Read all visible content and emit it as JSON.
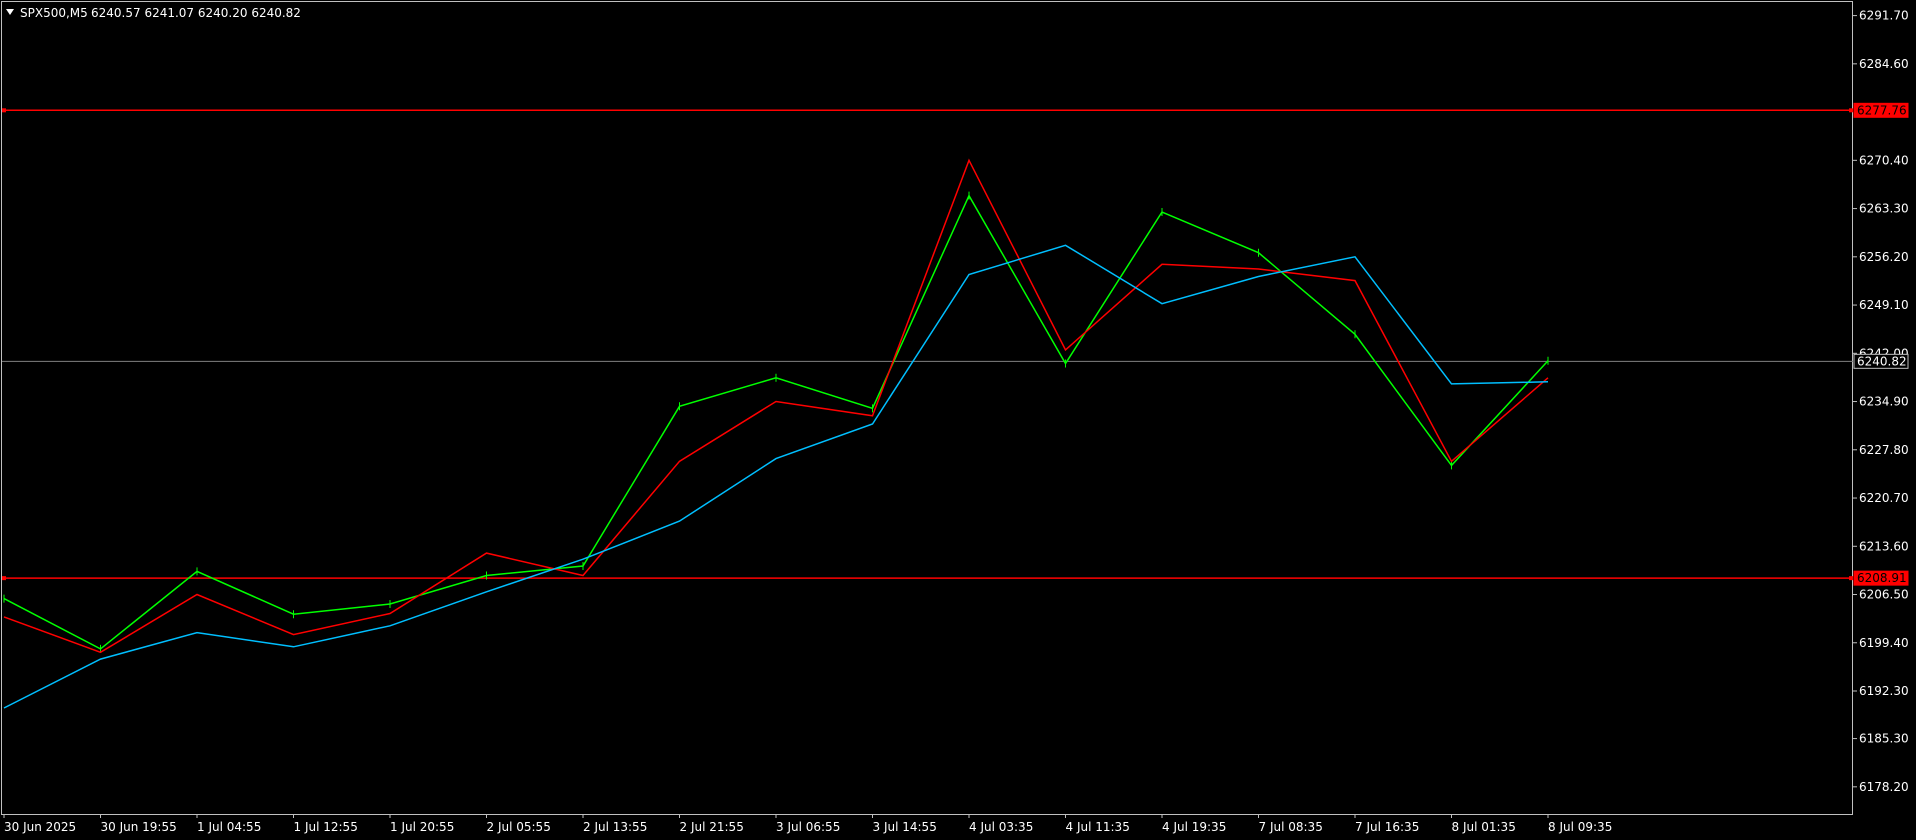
{
  "header": {
    "symbol_timeframe": "SPX500,M5",
    "ohlc": "6240.57 6241.07 6240.20 6240.82"
  },
  "colors": {
    "background": "#000000",
    "frame": "#c0c0c0",
    "text": "#ffffff",
    "bars": "#00ff00",
    "ma_fast": "#ff0000",
    "ma_slow": "#00bfff",
    "level_line": "#ff0000",
    "current_price_line": "#808080"
  },
  "icons": {
    "menu": "triangle-down-icon"
  },
  "chart_data": {
    "type": "line",
    "title": "",
    "xlabel": "",
    "ylabel": "",
    "ylim": [
      6174.2,
      6293.7
    ],
    "y_ticks": [
      "6291.70",
      "6284.60",
      "6270.40",
      "6263.30",
      "6256.20",
      "6249.10",
      "6242.00",
      "6234.90",
      "6227.80",
      "6220.70",
      "6213.60",
      "6206.50",
      "6199.40",
      "6192.30",
      "6185.30",
      "6178.20"
    ],
    "x_ticks": [
      "30 Jun 2025",
      "30 Jun 19:55",
      "1 Jul 04:55",
      "1 Jul 12:55",
      "1 Jul 20:55",
      "2 Jul 05:55",
      "2 Jul 13:55",
      "2 Jul 21:55",
      "3 Jul 06:55",
      "3 Jul 14:55",
      "4 Jul 03:35",
      "4 Jul 11:35",
      "4 Jul 19:35",
      "7 Jul 08:35",
      "7 Jul 16:35",
      "8 Jul 01:35",
      "8 Jul 09:35"
    ],
    "x": [
      "30 Jun 2025",
      "30 Jun 19:55",
      "1 Jul 04:55",
      "1 Jul 12:55",
      "1 Jul 20:55",
      "2 Jul 05:55",
      "2 Jul 13:55",
      "2 Jul 21:55",
      "3 Jul 06:55",
      "3 Jul 14:55",
      "4 Jul 03:35",
      "4 Jul 11:35",
      "4 Jul 19:35",
      "7 Jul 08:35",
      "7 Jul 16:35",
      "8 Jul 01:35",
      "8 Jul 09:35"
    ],
    "series": [
      {
        "values": [
          6205.9,
          6198.5,
          6209.9,
          6203.6,
          6205.1,
          6209.3,
          6210.7,
          6234.2,
          6238.4,
          6233.9,
          6265.2,
          6240.5,
          6262.8,
          6256.8,
          6244.8,
          6225.5,
          6240.9
        ]
      },
      {
        "values": [
          6203.2,
          6198.0,
          6206.5,
          6200.6,
          6203.7,
          6212.6,
          6209.3,
          6226.1,
          6234.9,
          6232.8,
          6270.4,
          6242.5,
          6255.1,
          6254.4,
          6252.7,
          6226.1,
          6238.4
        ]
      },
      {
        "values": [
          6189.8,
          6197.0,
          6200.9,
          6198.8,
          6201.9,
          6206.9,
          6211.7,
          6217.3,
          6226.5,
          6231.6,
          6253.6,
          6257.9,
          6249.3,
          6253.3,
          6256.2,
          6237.5,
          6237.8
        ]
      }
    ],
    "levels": [
      {
        "value": "6277.76"
      },
      {
        "value": "6208.91"
      }
    ],
    "current_price": "6240.82"
  }
}
